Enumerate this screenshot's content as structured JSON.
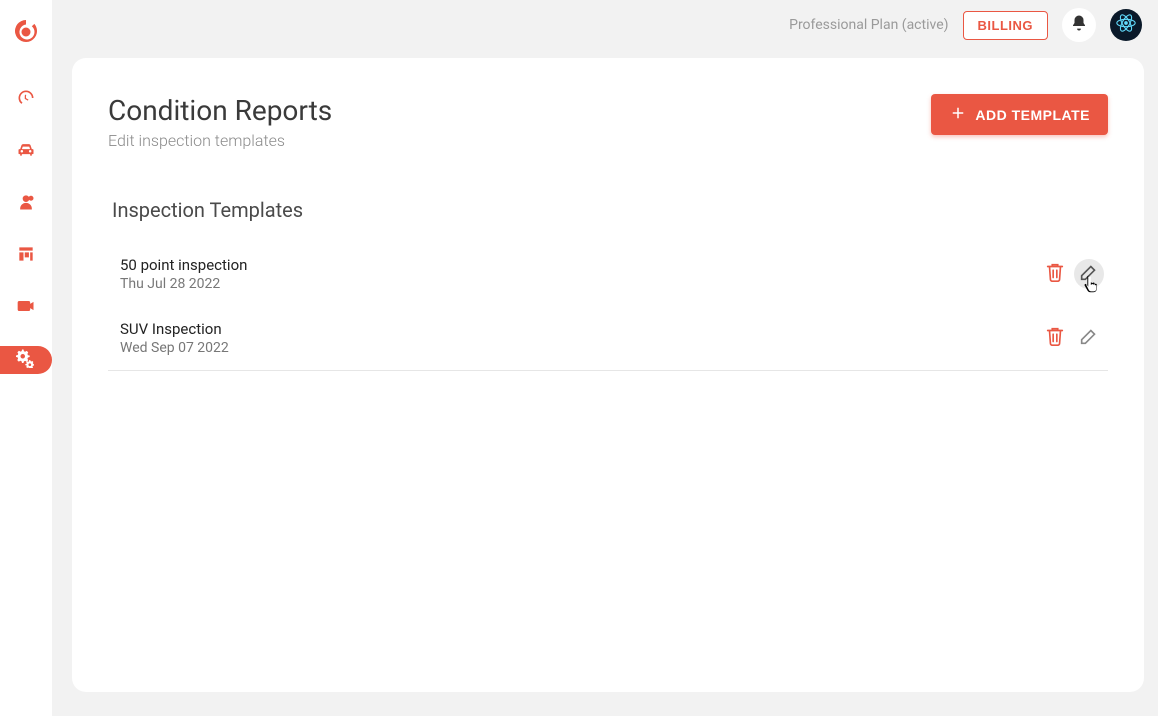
{
  "colors": {
    "accent": "#ea5743"
  },
  "sidebar": {
    "logo_name": "app-logo",
    "items": [
      {
        "name": "dashboard",
        "icon": "gauge-icon"
      },
      {
        "name": "vehicles",
        "icon": "car-icon"
      },
      {
        "name": "users",
        "icon": "people-icon"
      },
      {
        "name": "board",
        "icon": "kanban-icon"
      },
      {
        "name": "video",
        "icon": "video-icon"
      },
      {
        "name": "settings",
        "icon": "gears-icon",
        "active": true
      }
    ]
  },
  "topbar": {
    "plan_text": "Professional Plan (active)",
    "billing_label": "BILLING",
    "notif_icon": "bell-icon",
    "avatar_icon": "atom-icon"
  },
  "page": {
    "title": "Condition Reports",
    "subtitle": "Edit inspection templates",
    "add_button_label": "ADD TEMPLATE",
    "section_title": "Inspection Templates",
    "templates": [
      {
        "name": "50 point inspection",
        "date": "Thu Jul 28 2022"
      },
      {
        "name": "SUV Inspection",
        "date": "Wed Sep 07 2022"
      }
    ]
  }
}
